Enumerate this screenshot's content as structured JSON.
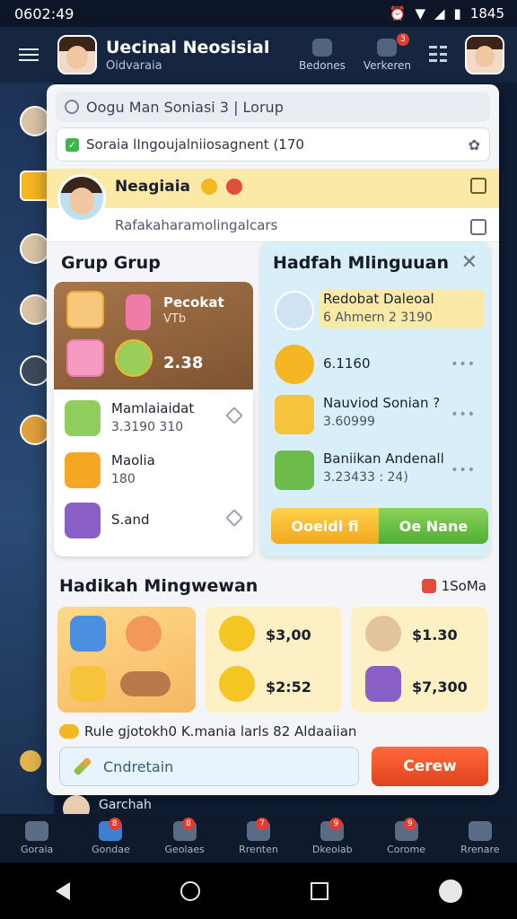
{
  "status_bar": {
    "time": "0602:49",
    "clock_right": "1845"
  },
  "header": {
    "title": "Uecinal Neosisial",
    "subtitle": "Oidvaraia",
    "actions": [
      {
        "label": "Bedones",
        "icon": "shield-icon",
        "badge": ""
      },
      {
        "label": "Verkeren",
        "icon": "bag-icon",
        "badge": "3"
      }
    ]
  },
  "sheet": {
    "search_text": "Oogu Man Soniasi 3 | Lorup",
    "notice_text": "Soraia lIngoujalniiosagnent (170",
    "user": {
      "name": "Neagiaia",
      "sub": "Rafakaharamolingalcars"
    }
  },
  "left_panel": {
    "title": "Grup Grup",
    "feature": {
      "title": "Pecokat",
      "sub": "VTb",
      "amount": "2.38"
    },
    "items": [
      {
        "name": "Mamlaiaidat",
        "value": "3.3190 310"
      },
      {
        "name": "Maolia",
        "value": "180"
      },
      {
        "name": "S.and",
        "value": ""
      }
    ]
  },
  "right_panel": {
    "title": "Hadfah Mlinguuan",
    "items": [
      {
        "name": "Redobat Daleoal",
        "value": "6 Ahmern 2 3190"
      },
      {
        "name": "6.1160",
        "value": ""
      },
      {
        "name": "Nauviod Sonian ?",
        "value": "3.60999"
      },
      {
        "name": "Baniikan Andenall",
        "value": "3.23433 : 24)"
      }
    ],
    "cta_left": "Ooeidi fi",
    "cta_right": "Oe Nane"
  },
  "bottom_section": {
    "title": "Hadikah Mingwewan",
    "right_label": "1SoMa",
    "prices": [
      {
        "top": "$3,00",
        "bottom": "$2:52"
      },
      {
        "top": "$1.30",
        "bottom": "$7,300"
      }
    ],
    "rule_text": "Rule gjotokh0 K.mania larls  82 Aldaaiian",
    "input_placeholder": "Cndretain",
    "go_label": "Cerew"
  },
  "peek_label": "Garchah",
  "bottom_nav": [
    {
      "label": "Goraia",
      "badge": ""
    },
    {
      "label": "Gondae",
      "badge": "8"
    },
    {
      "label": "Geolaes",
      "badge": "8"
    },
    {
      "label": "Rrenten",
      "badge": "7"
    },
    {
      "label": "Dkeoiab",
      "badge": "9"
    },
    {
      "label": "Corome",
      "badge": "9"
    },
    {
      "label": "Rrenare",
      "badge": ""
    }
  ]
}
